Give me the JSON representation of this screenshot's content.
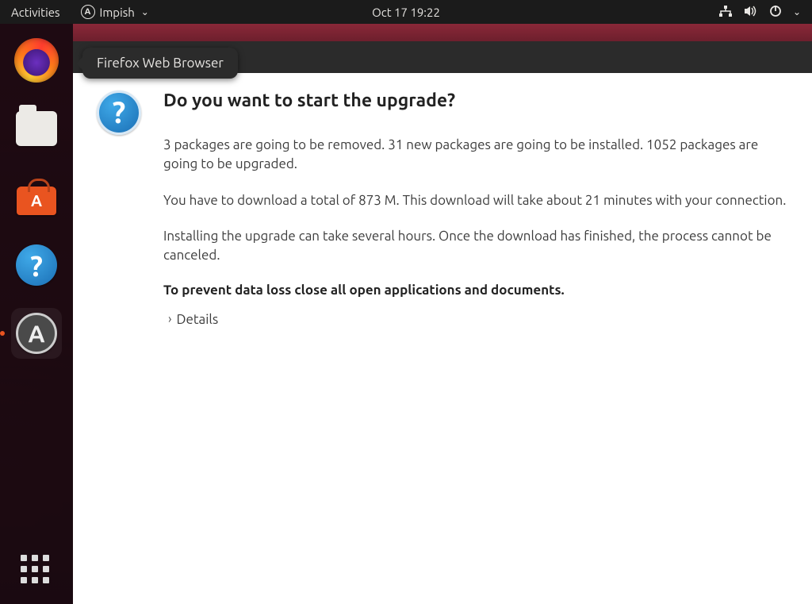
{
  "topbar": {
    "activities": "Activities",
    "app_name": "Impish",
    "datetime": "Oct 17  19:22"
  },
  "dock": {
    "items": [
      {
        "name": "firefox",
        "tooltip": "Firefox Web Browser"
      },
      {
        "name": "files"
      },
      {
        "name": "ubuntu-software"
      },
      {
        "name": "help"
      },
      {
        "name": "software-updater"
      }
    ]
  },
  "tooltip_text": "Firefox Web Browser",
  "dialog": {
    "title": "Do you want to start the upgrade?",
    "para1": "3 packages are going to be removed. 31 new packages are going to be installed. 1052 packages are going to be upgraded.",
    "para2": "You have to download a total of 873 M. This download will take about 21 minutes with your connection.",
    "para3": "Installing the upgrade can take several hours. Once the download has finished, the process cannot be canceled.",
    "warning": "To prevent data loss close all open applications and documents.",
    "details_label": "Details"
  }
}
